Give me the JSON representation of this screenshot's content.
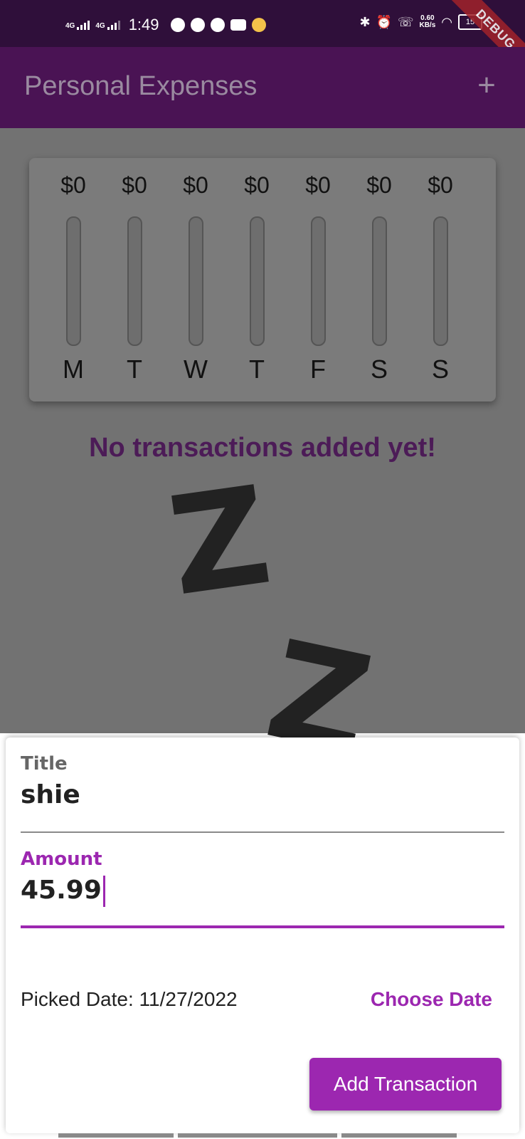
{
  "status_bar": {
    "network1": "4G",
    "network2": "4G",
    "time": "1:49",
    "speed_value": "0.60",
    "speed_unit": "KB/s",
    "battery": "15",
    "debug_label": "DEBUG"
  },
  "app_bar": {
    "title": "Personal Expenses",
    "add_icon": "+"
  },
  "chart": {
    "bars": [
      {
        "day": "M",
        "amount": "$0",
        "fill": 0
      },
      {
        "day": "T",
        "amount": "$0",
        "fill": 0
      },
      {
        "day": "W",
        "amount": "$0",
        "fill": 0
      },
      {
        "day": "T",
        "amount": "$0",
        "fill": 0
      },
      {
        "day": "F",
        "amount": "$0",
        "fill": 0
      },
      {
        "day": "S",
        "amount": "$0",
        "fill": 0
      },
      {
        "day": "S",
        "amount": "$0",
        "fill": 0
      }
    ]
  },
  "empty_state": {
    "message": "No transactions added yet!",
    "z1": "Z",
    "z2": "Z"
  },
  "sheet": {
    "title_label": "Title",
    "title_value": "shie",
    "amount_label": "Amount",
    "amount_value": "45.99",
    "picked_date": "Picked Date: 11/27/2022",
    "choose_date": "Choose Date",
    "submit": "Add Transaction"
  },
  "colors": {
    "primary": "#9c27b0",
    "app_bar": "#4a1354"
  }
}
